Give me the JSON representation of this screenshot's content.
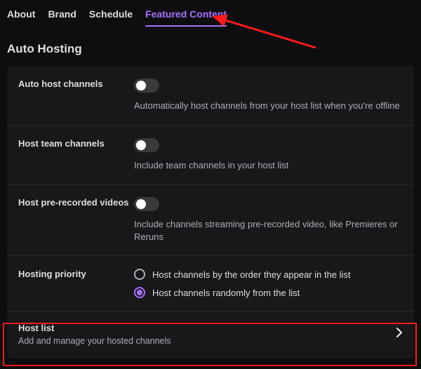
{
  "tabs": {
    "about": "About",
    "brand": "Brand",
    "schedule": "Schedule",
    "featured": "Featured Content"
  },
  "active_tab": "featured",
  "section_title": "Auto Hosting",
  "rows": {
    "auto_host": {
      "label": "Auto host channels",
      "desc": "Automatically host channels from your host list when you're offline",
      "enabled": false
    },
    "team": {
      "label": "Host team channels",
      "desc": "Include team channels in your host list",
      "enabled": false
    },
    "prerecorded": {
      "label": "Host pre-recorded videos",
      "desc": "Include channels streaming pre-recorded video, like Premieres or Reruns",
      "enabled": false
    },
    "priority": {
      "label": "Hosting priority",
      "opt_order": "Host channels by the order they appear in the list",
      "opt_random": "Host channels randomly from the list",
      "selected": "random"
    }
  },
  "hostlist": {
    "title": "Host list",
    "sub": "Add and manage your hosted channels"
  },
  "annotations": {
    "arrow_target": "tab-featured-content",
    "highlight_target": "host-list-row"
  }
}
